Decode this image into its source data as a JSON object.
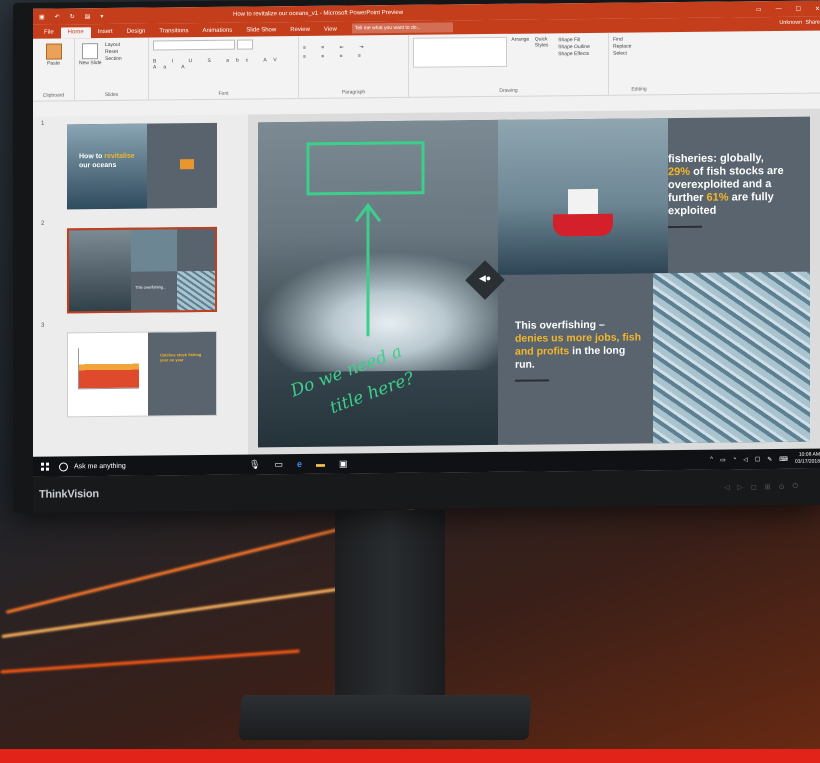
{
  "window": {
    "title": "How to revitalize our oceans_v1 - Microsoft PowerPoint Preview",
    "user": "Unknown",
    "share_label": "Share"
  },
  "tabs": [
    "File",
    "Home",
    "Insert",
    "Design",
    "Transitions",
    "Animations",
    "Slide Show",
    "Review",
    "View"
  ],
  "active_tab": "Home",
  "tell_me_placeholder": "Tell me what you want to do...",
  "ribbon": {
    "clipboard": {
      "paste": "Paste",
      "label": "Clipboard"
    },
    "slides": {
      "new_slide": "New Slide",
      "layout": "Layout",
      "reset": "Reset",
      "section": "Section",
      "label": "Slides"
    },
    "font": {
      "label": "Font"
    },
    "paragraph": {
      "label": "Paragraph"
    },
    "drawing": {
      "arrange": "Arrange",
      "quick_styles": "Quick Styles",
      "shape_fill": "Shape Fill",
      "shape_outline": "Shape Outline",
      "shape_effects": "Shape Effects",
      "label": "Drawing"
    },
    "editing": {
      "find": "Find",
      "replace": "Replace",
      "select": "Select",
      "label": "Editing"
    }
  },
  "thumbnails": [
    {
      "num": "1",
      "title_a": "How to ",
      "title_hl": "revitalise",
      "title_b": "our oceans"
    },
    {
      "num": "2",
      "text": "This overfishing..."
    },
    {
      "num": "3",
      "text": "Catches stock fishing year on year"
    }
  ],
  "slide": {
    "top_right_a": "fisheries: globally,",
    "top_right_hl1": "29%",
    "top_right_b": " of fish stocks are overexploited and a further ",
    "top_right_hl2": "61%",
    "top_right_c": " are fully exploited",
    "bottom_left_a": "This  overfishing –",
    "bottom_left_hl": "denies us more jobs, fish and profits",
    "bottom_left_b": " in the long run.",
    "ink_line1": "Do we need a",
    "ink_line2": "title here?"
  },
  "taskbar": {
    "search": "Ask me anything",
    "time": "10:08 AM",
    "date": "03/17/2018"
  },
  "brand": "ThinkVision",
  "colors": {
    "accent": "#c43e1c",
    "highlight": "#f3b72a",
    "ink": "#3ccf8c"
  }
}
